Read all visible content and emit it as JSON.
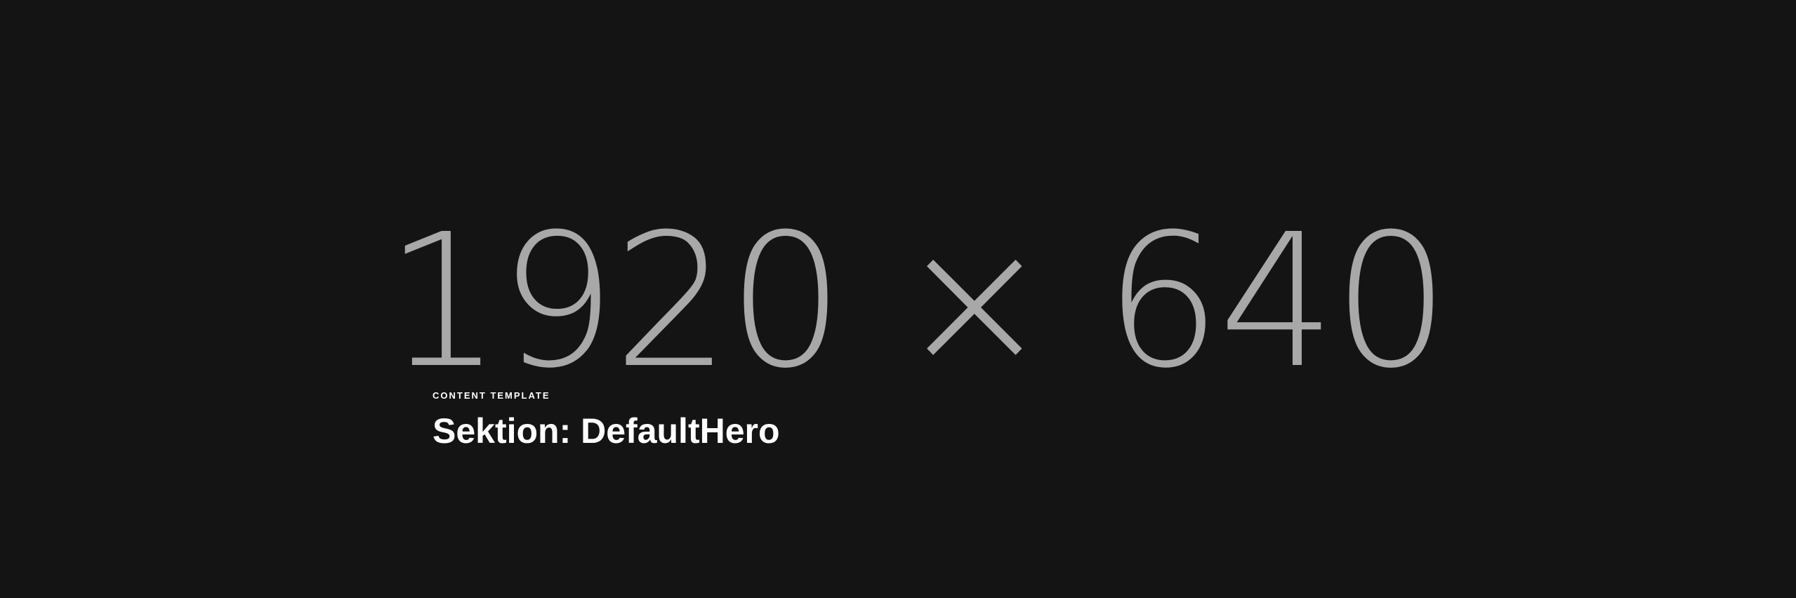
{
  "hero": {
    "placeholder_text": "1920 × 640",
    "eyebrow": "CONTENT TEMPLATE",
    "title": "Sektion: DefaultHero"
  },
  "colors": {
    "background": "#141414",
    "placeholder_text": "#a8a8a8",
    "heading_text": "#ffffff"
  }
}
